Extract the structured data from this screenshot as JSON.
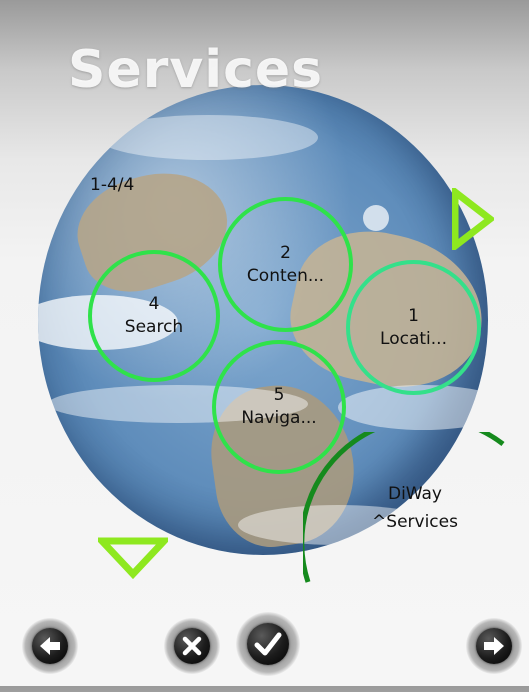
{
  "header": {
    "title": "Services"
  },
  "pager": {
    "text": "1-4/4"
  },
  "services": {
    "content": {
      "number": "2",
      "label": "Conten..."
    },
    "location": {
      "number": "1",
      "label": "Locati..."
    },
    "search": {
      "number": "4",
      "label": "Search"
    },
    "navigation": {
      "number": "5",
      "label": "Naviga..."
    }
  },
  "diway": {
    "line1": "DiWay",
    "line2": "^Services"
  },
  "toolbar": {
    "back_icon": "left-arrow-icon",
    "cancel_icon": "x-icon",
    "ok_icon": "check-icon",
    "forward_icon": "right-arrow-icon"
  },
  "colors": {
    "ring_green": "#2fe24a",
    "arrow_green": "#8ee81f",
    "arc_dark_green": "#158a1d"
  }
}
